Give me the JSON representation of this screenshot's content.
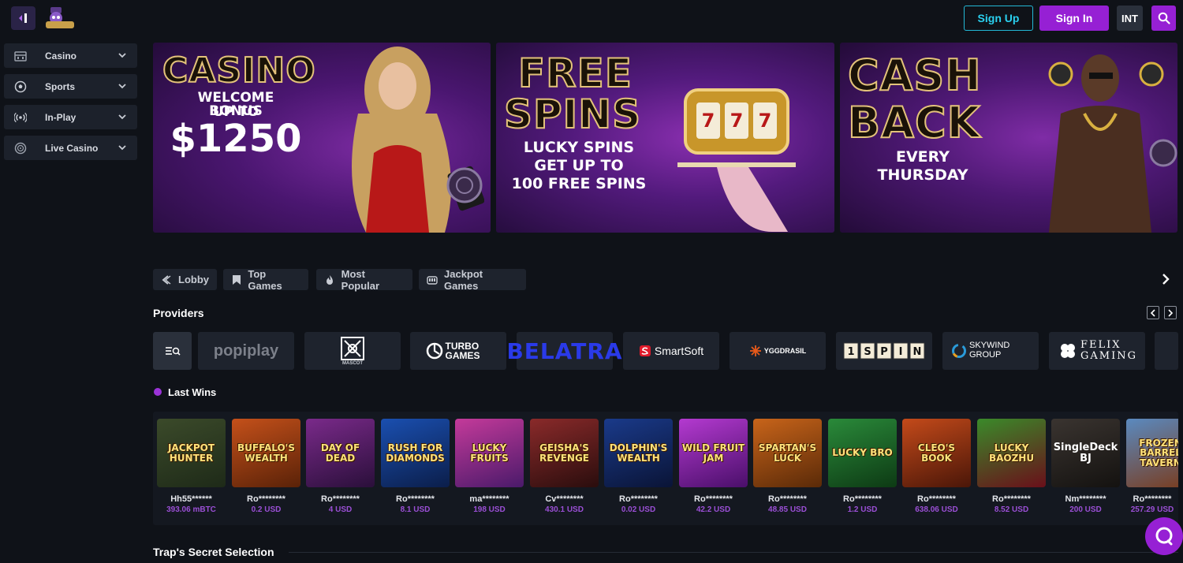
{
  "header": {
    "sign_up": "Sign Up",
    "sign_in": "Sign In",
    "language": "INT"
  },
  "sidebar": {
    "items": [
      {
        "label": "Casino",
        "icon": "casino-icon"
      },
      {
        "label": "Sports",
        "icon": "soccer-ball-icon"
      },
      {
        "label": "In-Play",
        "icon": "live-signal-icon"
      },
      {
        "label": "Live Casino",
        "icon": "roulette-icon"
      }
    ]
  },
  "banners": [
    {
      "title": "CASINO",
      "line1": "WELCOME BONUS",
      "line2": "UP TO",
      "amount": "$1250"
    },
    {
      "title1": "FREE",
      "title2": "SPINS",
      "line1": "LUCKY SPINS",
      "line2": "GET UP TO",
      "line3": "100 FREE SPINS"
    },
    {
      "title1": "CASH",
      "title2": "BACK",
      "line1": "EVERY",
      "line2": "THURSDAY"
    }
  ],
  "categories": [
    {
      "label": "Lobby",
      "icon": "lobby-icon"
    },
    {
      "label": "Top Games",
      "icon": "bookmark-icon"
    },
    {
      "label": "Most Popular",
      "icon": "fire-icon"
    },
    {
      "label": "Jackpot Games",
      "icon": "jackpot-icon"
    }
  ],
  "providers": {
    "title": "Providers",
    "items": [
      "popiplay",
      "MASCOT",
      "TURBO GAMES",
      "BELATRA",
      "SmartSoft",
      "YGGDRASIL",
      "1SPIN4WIN",
      "SKYWIND GROUP",
      "FELIX GAMING"
    ]
  },
  "last_wins": {
    "title": "Last Wins",
    "items": [
      {
        "game": "JACKPOT HUNTER",
        "user": "Hh55******",
        "amount": "393.06 mBTC",
        "color1": "#3b4a2a",
        "color2": "#1e2a18"
      },
      {
        "game": "BUFFALO'S WEALTH",
        "user": "Ro********",
        "amount": "0.2 USD",
        "color1": "#c4501a",
        "color2": "#5a2208"
      },
      {
        "game": "DAY OF DEAD",
        "user": "Ro********",
        "amount": "4 USD",
        "color1": "#7a2a8a",
        "color2": "#2a0f3a"
      },
      {
        "game": "RUSH FOR DIAMONDS",
        "user": "Ro********",
        "amount": "8.1 USD",
        "color1": "#1a4fb0",
        "color2": "#0b1e4a"
      },
      {
        "game": "LUCKY FRUITS",
        "user": "ma********",
        "amount": "198 USD",
        "color1": "#c43a9a",
        "color2": "#4a1a6a"
      },
      {
        "game": "GEISHA'S REVENGE",
        "user": "Cv********",
        "amount": "430.1 USD",
        "color1": "#8a2a2a",
        "color2": "#2a0d0d"
      },
      {
        "game": "DOLPHIN'S WEALTH",
        "user": "Ro********",
        "amount": "0.02 USD",
        "color1": "#1a3a8a",
        "color2": "#0a1436"
      },
      {
        "game": "WILD FRUIT JAM",
        "user": "Ro********",
        "amount": "42.2 USD",
        "color1": "#b43ad0",
        "color2": "#4a0f6a"
      },
      {
        "game": "SPARTAN'S LUCK",
        "user": "Ro********",
        "amount": "48.85 USD",
        "color1": "#c8641a",
        "color2": "#5a2a08"
      },
      {
        "game": "LUCKY BRO",
        "user": "Ro********",
        "amount": "1.2 USD",
        "color1": "#2a8a3a",
        "color2": "#0d3a14"
      },
      {
        "game": "CLEO'S BOOK",
        "user": "Ro********",
        "amount": "638.06 USD",
        "color1": "#c44a1a",
        "color2": "#4a1608"
      },
      {
        "game": "LUCKY BAOZHU",
        "user": "Ro********",
        "amount": "8.52 USD",
        "color1": "#3a8a2a",
        "color2": "#6a0f1a"
      },
      {
        "game": "SingleDeck BJ",
        "user": "Nm********",
        "amount": "200 USD",
        "color1": "#3a3430",
        "color2": "#141210"
      },
      {
        "game": "FROZEN BARREL TAVERN",
        "user": "Ro********",
        "amount": "257.29 USD",
        "color1": "#5a8ac0",
        "color2": "#7a3a1a"
      }
    ]
  },
  "trap_section": {
    "title": "Trap's Secret Selection"
  },
  "colors": {
    "accent": "#9620d4",
    "signup": "#23b9d6",
    "amount": "#9b4fd6",
    "bg": "#0f1218"
  }
}
